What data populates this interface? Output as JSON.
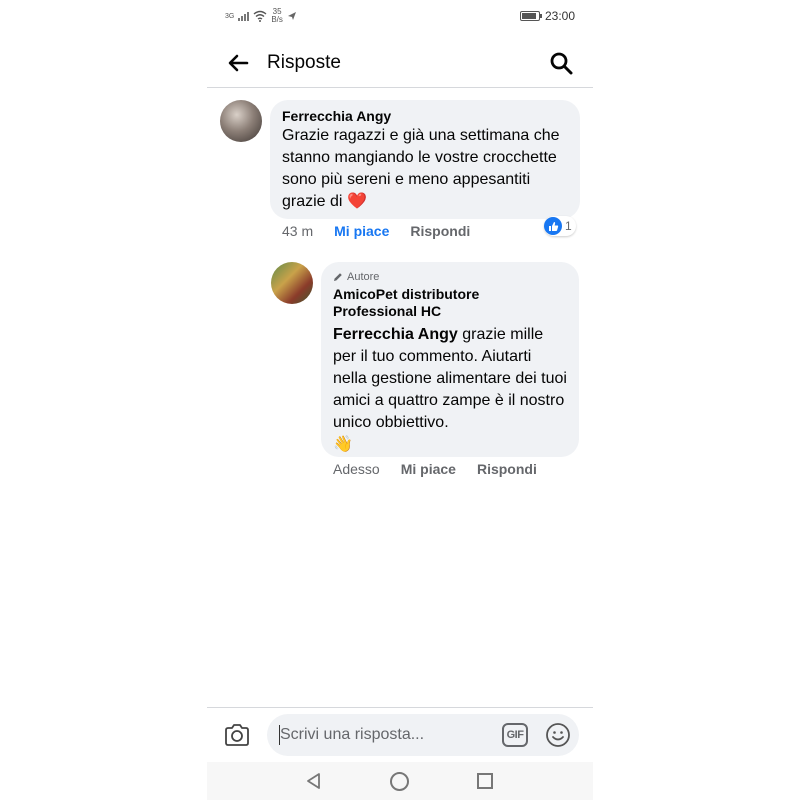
{
  "status_bar": {
    "network": "3G",
    "data_rate_value": "35",
    "data_rate_unit": "B/s",
    "time": "23:00",
    "battery_level": 0.9
  },
  "header": {
    "title": "Risposte",
    "back_icon": "back-arrow-icon",
    "search_icon": "search-icon"
  },
  "comments": [
    {
      "author": "Ferrecchia Angy",
      "text": "Grazie ragazzi e già una settimana che stanno mangiando le vostre crocchette sono più sereni e meno appesantiti grazie di",
      "emoji": "❤️",
      "time": "43 m",
      "like_label": "Mi piace",
      "reply_label": "Rispondi",
      "reaction_count": "1",
      "liked": true
    },
    {
      "badge": "Autore",
      "author": "AmicoPet distributore Professional HC",
      "mention": "Ferrecchia Angy",
      "text": " grazie mille per il tuo commento. Aiutarti nella gestione alimentare dei tuoi amici a quattro zampe è il nostro unico obbiettivo.",
      "emoji": "👋",
      "time": "Adesso",
      "like_label": "Mi piace",
      "reply_label": "Rispondi"
    }
  ],
  "composer": {
    "placeholder": "Scrivi una risposta...",
    "gif_label": "GIF",
    "camera_icon": "camera-icon",
    "emoji_icon": "emoji-icon"
  },
  "colors": {
    "accent": "#1877f2",
    "bubble": "#f0f2f5",
    "secondary_text": "#65676b"
  }
}
